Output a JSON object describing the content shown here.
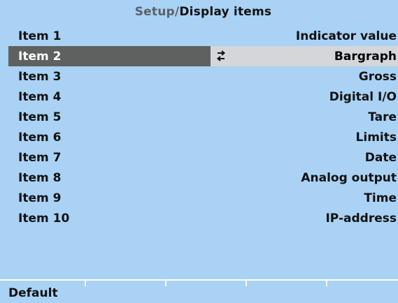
{
  "header": {
    "title_prefix": "Setup",
    "separator": "/",
    "title": "Display items"
  },
  "items": [
    {
      "label": "Item 1",
      "value": "Indicator value"
    },
    {
      "label": "Item 2",
      "value": "Bargraph",
      "selected": true
    },
    {
      "label": "Item 3",
      "value": "Gross"
    },
    {
      "label": "Item 4",
      "value": "Digital I/O"
    },
    {
      "label": "Item 5",
      "value": "Tare"
    },
    {
      "label": "Item 6",
      "value": "Limits"
    },
    {
      "label": "Item 7",
      "value": "Date"
    },
    {
      "label": "Item 8",
      "value": "Analog output"
    },
    {
      "label": "Item 9",
      "value": "Time"
    },
    {
      "label": "Item 10",
      "value": "IP-address"
    }
  ],
  "softkeys": {
    "key1": "Default"
  },
  "icons": {
    "selector": "swap-arrows-icon"
  },
  "colors": {
    "background": "#a9d2f5",
    "selected_label_bg": "#5f6060",
    "selected_value_bg": "#d4d6d8"
  }
}
